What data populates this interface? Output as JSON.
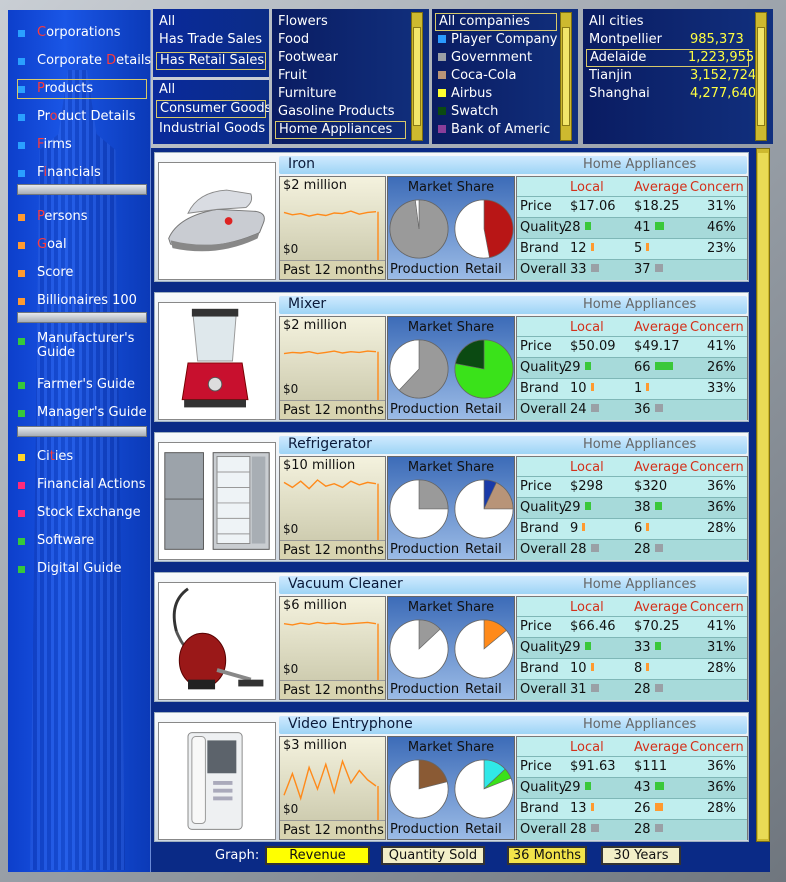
{
  "sidebar": {
    "items": [
      {
        "name": "nav-corporations",
        "label": "Corporations",
        "color": "#2aa0ff",
        "hl": 0,
        "hl_len": 1
      },
      {
        "name": "nav-corporate-details",
        "label": "Corporate Details",
        "color": "#2aa0ff",
        "hl": 10,
        "hl_len": 1
      },
      {
        "name": "nav-products",
        "label": "Products",
        "color": "#2aa0ff",
        "hl": 0,
        "hl_len": 1,
        "selected": true
      },
      {
        "name": "nav-product-details",
        "label": "Product Details",
        "color": "#2aa0ff",
        "hl": 2,
        "hl_len": 1
      },
      {
        "name": "nav-firms",
        "label": "Firms",
        "color": "#2aa0ff",
        "hl": 0,
        "hl_len": 1
      },
      {
        "name": "nav-financials",
        "label": "Financials",
        "color": "#2aa0ff",
        "hl": 1,
        "hl_len": 1
      },
      {
        "name": "nav-persons",
        "label": "Persons",
        "color": "#ff9a30",
        "hl": 0,
        "hl_len": 1
      },
      {
        "name": "nav-goal",
        "label": "Goal",
        "color": "#ff9a30",
        "hl": 0,
        "hl_len": 1
      },
      {
        "name": "nav-score",
        "label": "Score",
        "color": "#ff9a30",
        "hl": -1,
        "hl_len": 0
      },
      {
        "name": "nav-billionaires",
        "label": "Billionaires 100",
        "color": "#ff9a30",
        "hl": -1,
        "hl_len": 0
      },
      {
        "name": "nav-manufacturers-guide",
        "label": "Manufacturer's\nGuide",
        "color": "#36c83a",
        "hl": -1,
        "hl_len": 0
      },
      {
        "name": "nav-farmers-guide",
        "label": "Farmer's Guide",
        "color": "#36c83a",
        "hl": -1,
        "hl_len": 0
      },
      {
        "name": "nav-managers-guide",
        "label": "Manager's Guide",
        "color": "#36c83a",
        "hl": -1,
        "hl_len": 0
      },
      {
        "name": "nav-cities",
        "label": "Cities",
        "color": "#ffd52a",
        "hl": 2,
        "hl_len": 1
      },
      {
        "name": "nav-financial-actions",
        "label": "Financial Actions",
        "color": "#ff2a7a",
        "hl": -1,
        "hl_len": 0
      },
      {
        "name": "nav-stock-exchange",
        "label": "Stock Exchange",
        "color": "#ff2a7a",
        "hl": -1,
        "hl_len": 0
      },
      {
        "name": "nav-software",
        "label": "Software",
        "color": "#36c83a",
        "hl": -1,
        "hl_len": 0
      },
      {
        "name": "nav-digital-guide",
        "label": "Digital Guide",
        "color": "#36c83a",
        "hl": -1,
        "hl_len": 0
      }
    ]
  },
  "filters": {
    "sales": [
      "All",
      "Has Trade Sales",
      "Has Retail Sales"
    ],
    "sales_selected": 2,
    "goods": [
      "All",
      "Consumer Goods",
      "Industrial Goods"
    ],
    "goods_selected": 1,
    "categories": [
      "Flowers",
      "Food",
      "Footwear",
      "Fruit",
      "Furniture",
      "Gasoline Products",
      "Home Appliances"
    ],
    "categories_selected": 6,
    "companies": [
      {
        "label": "All companies",
        "color": ""
      },
      {
        "label": "Player Company",
        "color": "#2a9bff"
      },
      {
        "label": "Government",
        "color": "#9aa0a6"
      },
      {
        "label": "Coca-Cola",
        "color": "#b89478"
      },
      {
        "label": "Airbus",
        "color": "#ffff30"
      },
      {
        "label": "Swatch",
        "color": "#0b4a12"
      },
      {
        "label": "Bank of Americ",
        "color": "#8a3e9a"
      }
    ],
    "companies_selected": 0,
    "cities": [
      {
        "label": "All cities",
        "value": ""
      },
      {
        "label": "Montpellier",
        "value": "985,373"
      },
      {
        "label": "Adelaide",
        "value": "1,223,955"
      },
      {
        "label": "Tianjin",
        "value": "3,152,724"
      },
      {
        "label": "Shanghai",
        "value": "4,277,640"
      }
    ],
    "cities_selected": 2
  },
  "common": {
    "market_share": "Market Share",
    "production": "Production",
    "retail": "Retail",
    "past": "Past 12 months",
    "zero": "$0",
    "col_local": "Local",
    "col_average": "Average",
    "col_concern": "Concern",
    "row_price": "Price",
    "row_quality": "Quality",
    "row_brand": "Brand",
    "row_overall": "Overall"
  },
  "products": [
    {
      "name": "Iron",
      "category": "Home Appliances",
      "graph_label": "$2 million",
      "production_share": [
        {
          "color": "#9a9a9a",
          "frac": 0.98
        },
        {
          "color": "#ffffff",
          "frac": 0.02
        }
      ],
      "retail_share": [
        {
          "color": "#b81616",
          "frac": 0.47
        },
        {
          "color": "#ffffff",
          "frac": 0.53
        }
      ],
      "price": {
        "local": "$17.06",
        "avg": "$18.25",
        "concern": "31%"
      },
      "quality": {
        "local": "28",
        "avg": "41",
        "concern": "46%",
        "local_bar": 6,
        "avg_bar": 9
      },
      "brand": {
        "local": "12",
        "avg": "5",
        "concern": "23%"
      },
      "overall": {
        "local": "33",
        "avg": "37"
      },
      "series": [
        0.72,
        0.68,
        0.7,
        0.66,
        0.69,
        0.67,
        0.71,
        0.7,
        0.74,
        0.69,
        0.72,
        0.73
      ]
    },
    {
      "name": "Mixer",
      "category": "Home Appliances",
      "graph_label": "$2 million",
      "production_share": [
        {
          "color": "#9a9a9a",
          "frac": 0.62
        },
        {
          "color": "#ffffff",
          "frac": 0.38
        }
      ],
      "retail_share": [
        {
          "color": "#3ae21a",
          "frac": 0.78
        },
        {
          "color": "#0b4a12",
          "frac": 0.22
        }
      ],
      "price": {
        "local": "$50.09",
        "avg": "$49.17",
        "concern": "41%"
      },
      "quality": {
        "local": "29",
        "avg": "66",
        "concern": "26%",
        "local_bar": 6,
        "avg_bar": 18
      },
      "brand": {
        "local": "10",
        "avg": "1",
        "concern": "33%"
      },
      "overall": {
        "local": "24",
        "avg": "36"
      },
      "series": [
        0.7,
        0.72,
        0.71,
        0.73,
        0.7,
        0.72,
        0.74,
        0.71,
        0.73,
        0.72,
        0.74,
        0.73
      ]
    },
    {
      "name": "Refrigerator",
      "category": "Home Appliances",
      "graph_label": "$10 million",
      "production_share": [
        {
          "color": "#9a9a9a",
          "frac": 0.25
        },
        {
          "color": "#ffffff",
          "frac": 0.75
        }
      ],
      "retail_share": [
        {
          "color": "#1a3aa8",
          "frac": 0.07
        },
        {
          "color": "#b89478",
          "frac": 0.18
        },
        {
          "color": "#ffffff",
          "frac": 0.75
        }
      ],
      "price": {
        "local": "$298",
        "avg": "$320",
        "concern": "36%"
      },
      "quality": {
        "local": "29",
        "avg": "38",
        "concern": "36%",
        "local_bar": 6,
        "avg_bar": 7
      },
      "brand": {
        "local": "9",
        "avg": "6",
        "concern": "28%"
      },
      "overall": {
        "local": "28",
        "avg": "28"
      },
      "series": [
        0.88,
        0.8,
        0.9,
        0.78,
        0.92,
        0.82,
        0.86,
        0.8,
        0.9,
        0.84,
        0.88,
        0.86
      ]
    },
    {
      "name": "Vacuum Cleaner",
      "category": "Home Appliances",
      "graph_label": "$6 million",
      "production_share": [
        {
          "color": "#9a9a9a",
          "frac": 0.13
        },
        {
          "color": "#ffffff",
          "frac": 0.87
        }
      ],
      "retail_share": [
        {
          "color": "#ff8a1a",
          "frac": 0.14
        },
        {
          "color": "#ffffff",
          "frac": 0.86
        }
      ],
      "price": {
        "local": "$66.46",
        "avg": "$70.25",
        "concern": "41%"
      },
      "quality": {
        "local": "29",
        "avg": "33",
        "concern": "31%",
        "local_bar": 6,
        "avg_bar": 6
      },
      "brand": {
        "local": "10",
        "avg": "8",
        "concern": "28%"
      },
      "overall": {
        "local": "31",
        "avg": "28"
      },
      "series": [
        0.86,
        0.84,
        0.87,
        0.85,
        0.88,
        0.86,
        0.87,
        0.85,
        0.86,
        0.87,
        0.88,
        0.86
      ]
    },
    {
      "name": "Video Entryphone",
      "category": "Home Appliances",
      "graph_label": "$3 million",
      "production_share": [
        {
          "color": "#8a5a34",
          "frac": 0.21
        },
        {
          "color": "#ffffff",
          "frac": 0.79
        }
      ],
      "retail_share": [
        {
          "color": "#30e8e8",
          "frac": 0.13
        },
        {
          "color": "#3ae21a",
          "frac": 0.06
        },
        {
          "color": "#ffffff",
          "frac": 0.81
        }
      ],
      "price": {
        "local": "$91.63",
        "avg": "$111",
        "concern": "36%"
      },
      "quality": {
        "local": "29",
        "avg": "43",
        "concern": "36%",
        "local_bar": 6,
        "avg_bar": 9
      },
      "brand": {
        "local": "13",
        "avg": "26",
        "concern": "28%"
      },
      "overall": {
        "local": "28",
        "avg": "28"
      },
      "series": [
        0.35,
        0.7,
        0.3,
        0.8,
        0.45,
        0.85,
        0.4,
        0.9,
        0.55,
        0.75,
        0.6,
        0.5
      ]
    }
  ],
  "bottom": {
    "graph_label": "Graph:",
    "revenue": "Revenue",
    "quantity": "Quantity Sold",
    "months": "36 Months",
    "years": "30 Years"
  }
}
